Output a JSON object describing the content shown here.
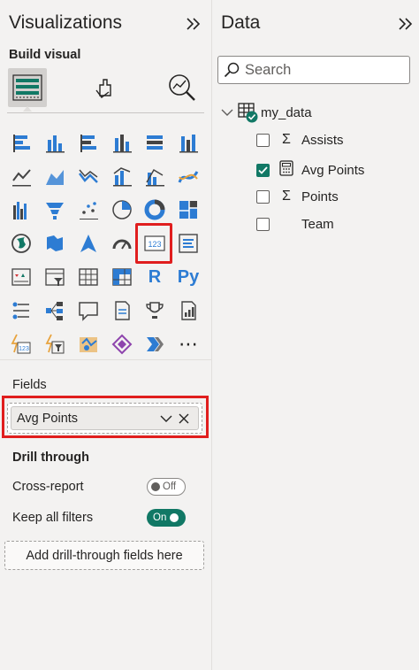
{
  "visualizations": {
    "title": "Visualizations",
    "build_visual_label": "Build visual",
    "modes": [
      "build-visual",
      "format-visual",
      "analytics"
    ],
    "text_icons": {
      "r": "R",
      "py": "Py",
      "more": "⋯"
    },
    "fields_label": "Fields",
    "field_well": {
      "value": "Avg Points"
    },
    "drill_through": {
      "title": "Drill through",
      "cross_report_label": "Cross-report",
      "cross_report_state": "Off",
      "keep_filters_label": "Keep all filters",
      "keep_filters_state": "On",
      "add_fields_placeholder": "Add drill-through fields here"
    }
  },
  "data_pane": {
    "title": "Data",
    "search_placeholder": "Search",
    "table": {
      "name": "my_data",
      "fields": [
        {
          "name": "Assists",
          "type": "sum",
          "type_glyph": "Σ",
          "checked": false
        },
        {
          "name": "Avg Points",
          "type": "measure",
          "type_glyph": "",
          "checked": true
        },
        {
          "name": "Points",
          "type": "sum",
          "type_glyph": "Σ",
          "checked": false
        },
        {
          "name": "Team",
          "type": "text",
          "type_glyph": "",
          "checked": false
        }
      ]
    }
  },
  "colors": {
    "accent": "#117865",
    "highlight_red": "#e01e1e",
    "icon_blue": "#2d7cd3",
    "icon_dark": "#444444"
  }
}
